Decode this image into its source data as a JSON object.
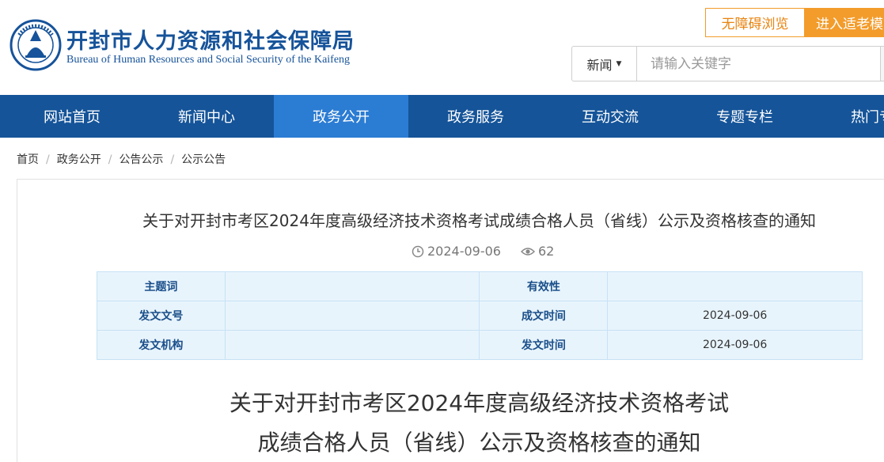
{
  "header": {
    "title": "开封市人力资源和社会保障局",
    "subtitle": "Bureau of Human Resources and Social Security of the Kaifeng",
    "logo_icon": "kaifeng-hrss-emblem-icon",
    "brand_color": "#16539a"
  },
  "accessibility": {
    "barrier_free_label": "无障碍浏览",
    "elder_mode_label": "进入适老模式",
    "accent_color": "#f39c2b"
  },
  "search": {
    "category": "新闻",
    "placeholder": "请输入关键字"
  },
  "nav": {
    "items": [
      {
        "label": "网站首页"
      },
      {
        "label": "新闻中心"
      },
      {
        "label": "政务公开",
        "active": true
      },
      {
        "label": "政务服务"
      },
      {
        "label": "互动交流"
      },
      {
        "label": "专题专栏"
      },
      {
        "label": "热门专题"
      }
    ],
    "bg_color": "#155499",
    "active_color": "#2b7cd3"
  },
  "breadcrumb": {
    "items": [
      "首页",
      "政务公开",
      "公告公示",
      "公示公告"
    ],
    "separator": "/"
  },
  "article": {
    "title": "关于对开封市考区2024年度高级经济技术资格考试成绩合格人员（省线）公示及资格核查的通知",
    "date": "2024-09-06",
    "views": "62",
    "body_title_line1": "关于对开封市考区2024年度高级经济技术资格考试",
    "body_title_line2": "成绩合格人员（省线）公示及资格核查的通知"
  },
  "info_table": {
    "rows": [
      {
        "label1": "主题词",
        "value1": "",
        "label2": "有效性",
        "value2": ""
      },
      {
        "label1": "发文文号",
        "value1": "",
        "label2": "成文时间",
        "value2": "2024-09-06"
      },
      {
        "label1": "发文机构",
        "value1": "",
        "label2": "发文时间",
        "value2": "2024-09-06"
      }
    ]
  }
}
